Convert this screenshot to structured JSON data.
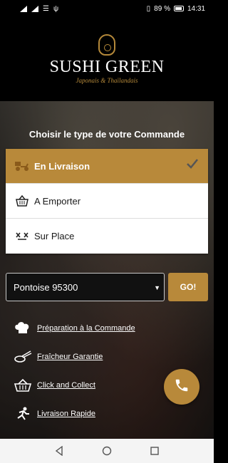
{
  "status": {
    "battery": "89 %",
    "time": "14:31"
  },
  "brand": {
    "name": "SUSHI GREEN",
    "tagline": "Japonais & Thaïlandais"
  },
  "order": {
    "title": "Choisir le type de votre Commande",
    "options": [
      {
        "label": "En Livraison",
        "icon": "delivery-scooter-icon",
        "selected": true
      },
      {
        "label": "A Emporter",
        "icon": "basket-icon",
        "selected": false
      },
      {
        "label": "Sur Place",
        "icon": "dining-icon",
        "selected": false
      }
    ]
  },
  "city": {
    "selected": "Pontoise 95300",
    "go_label": "GO!"
  },
  "features": [
    {
      "label": "Préparation à la Commande",
      "icon": "chef-hat-icon"
    },
    {
      "label": "Fraîcheur Garantie",
      "icon": "sushi-chopsticks-icon"
    },
    {
      "label": "Click and Collect",
      "icon": "basket-icon"
    },
    {
      "label": "Livraison Rapide",
      "icon": "delivery-runner-icon"
    }
  ],
  "colors": {
    "accent": "#b8893a",
    "background": "#000000"
  }
}
